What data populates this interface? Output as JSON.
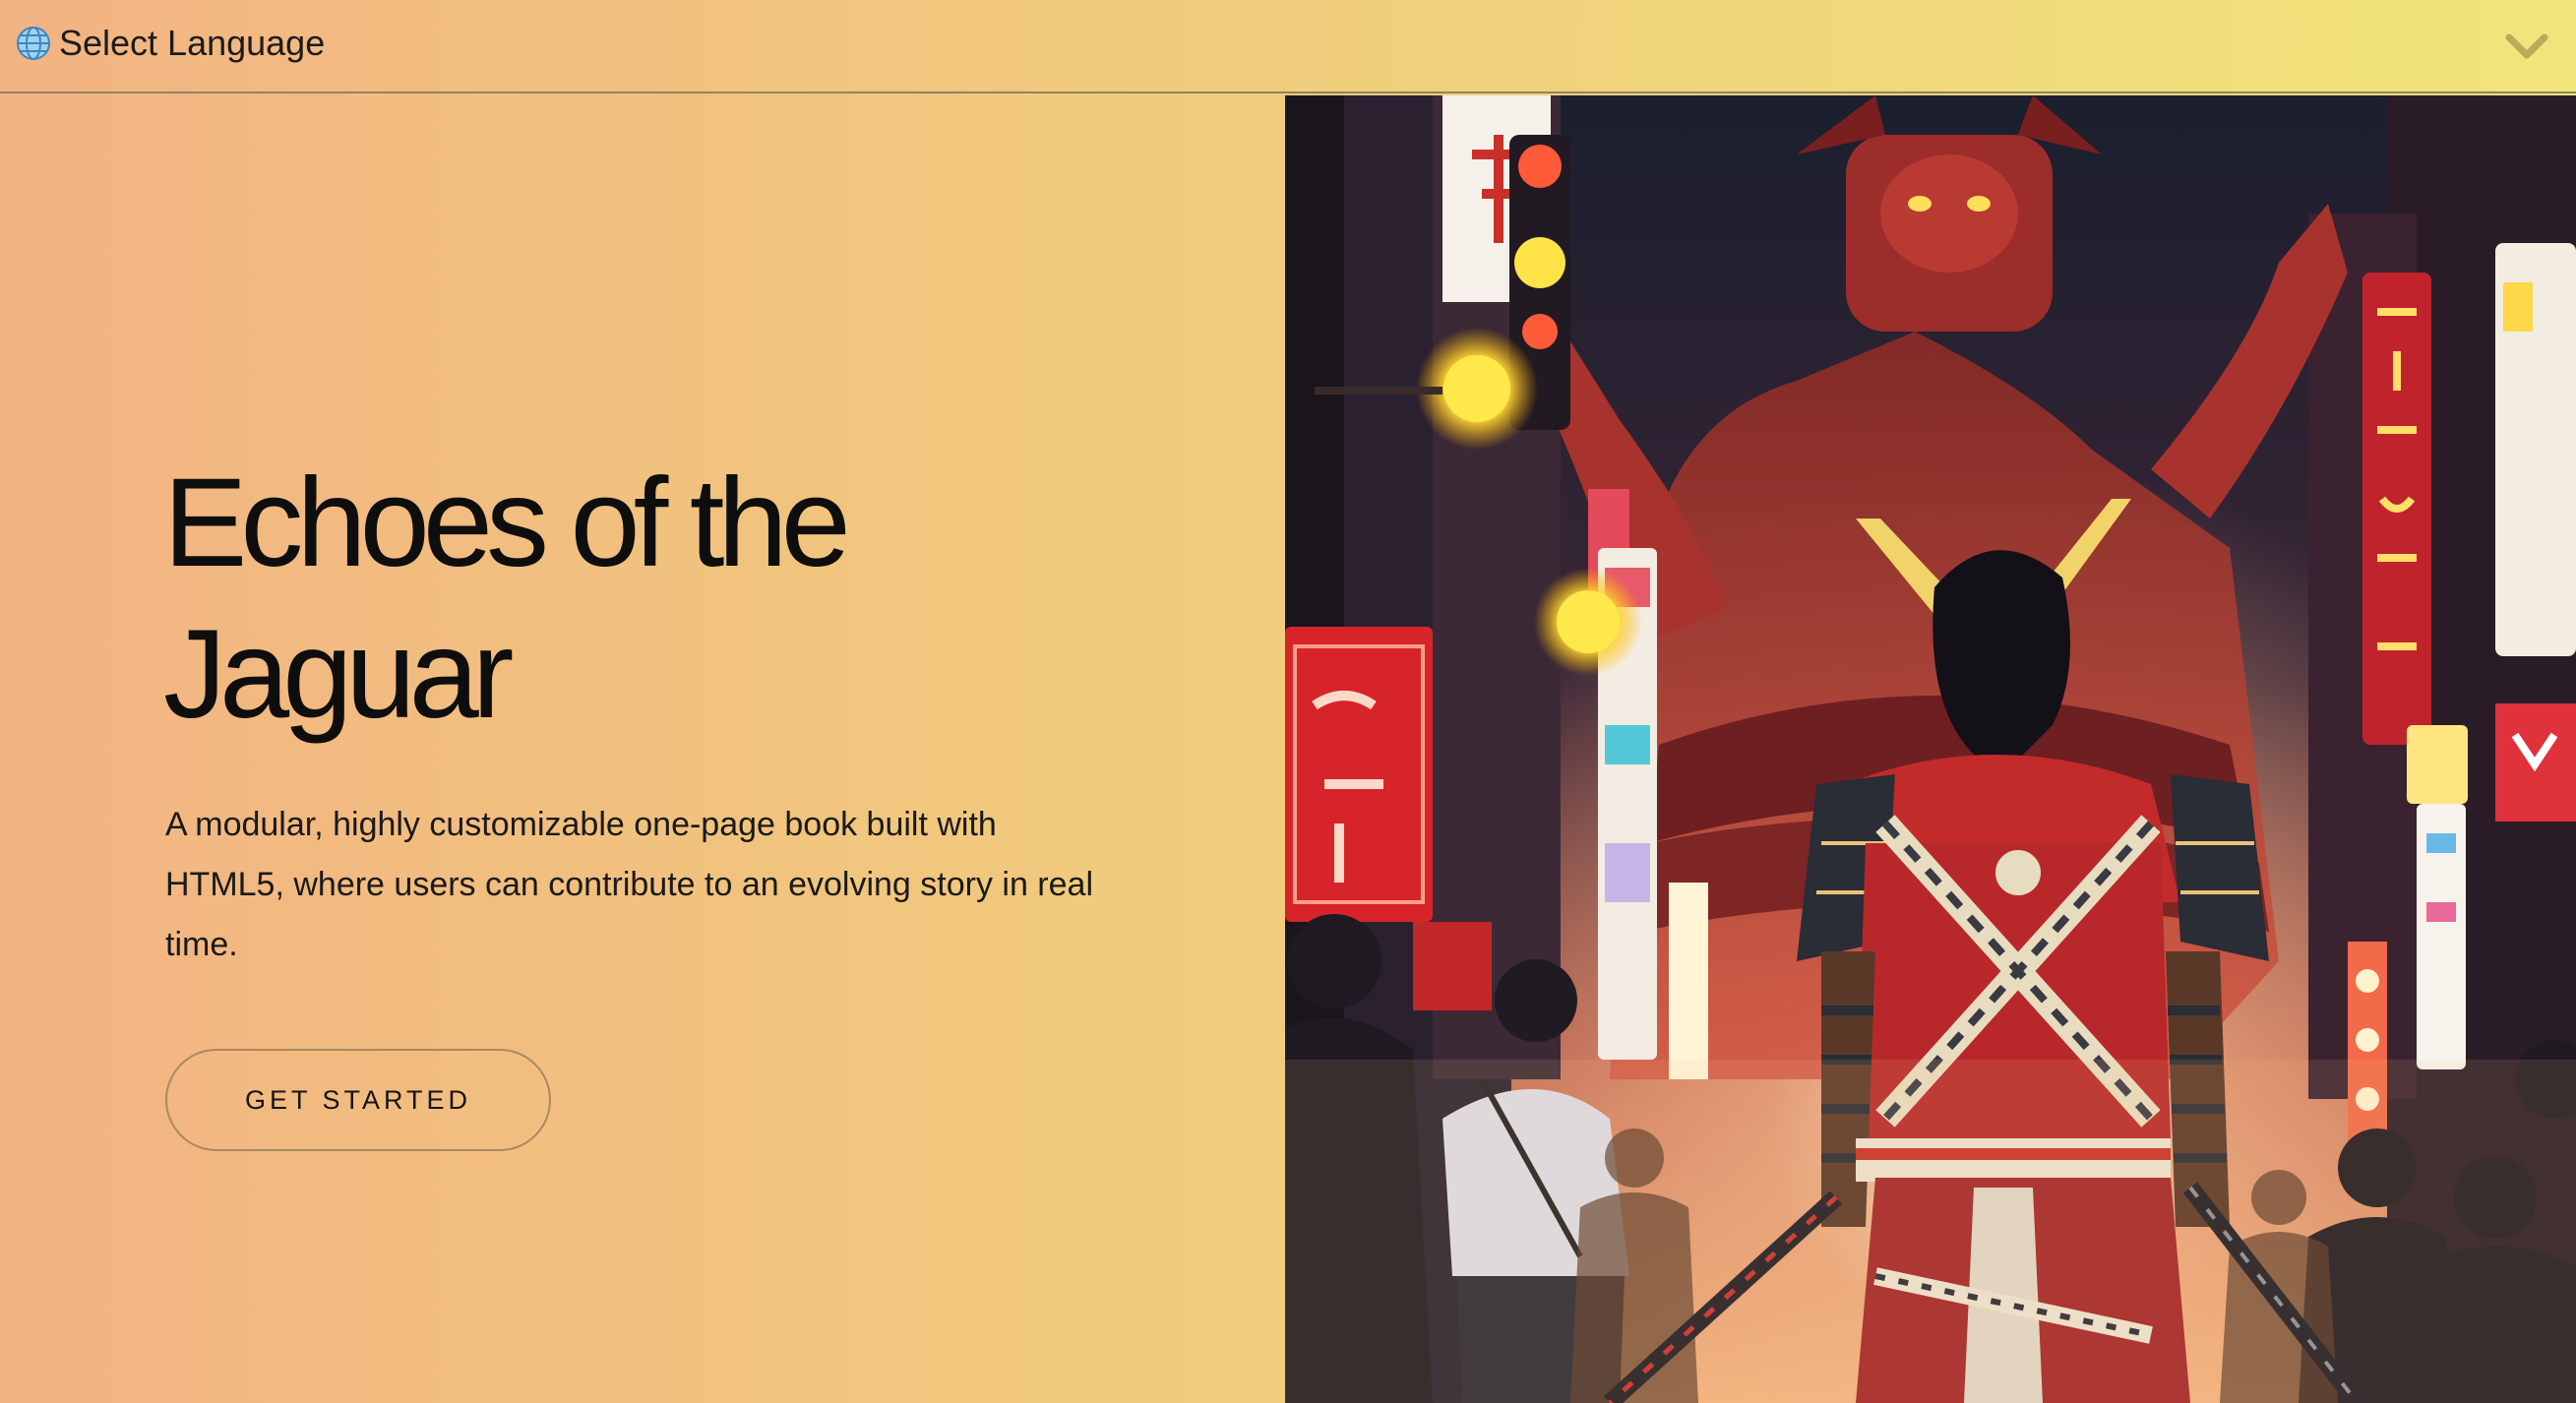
{
  "language_selector": {
    "label": "Select Language",
    "icons": {
      "globe": "globe-icon",
      "dropdown": "chevron-down-icon"
    }
  },
  "hero": {
    "title_line1": "Echoes of the",
    "title_line2": "Jaguar",
    "description": "A modular, highly customizable one-page book built with HTML5, where users can contribute to an evolving story in real time.",
    "cta_label": "GET STARTED"
  },
  "illustration": {
    "subject": "samurai-warrior-neon-city-illustration"
  },
  "colors": {
    "gradient_start": "#f2b383",
    "gradient_end": "#f1e57a",
    "accent_red": "#c8302a",
    "neon_yellow": "#ffe24a"
  }
}
